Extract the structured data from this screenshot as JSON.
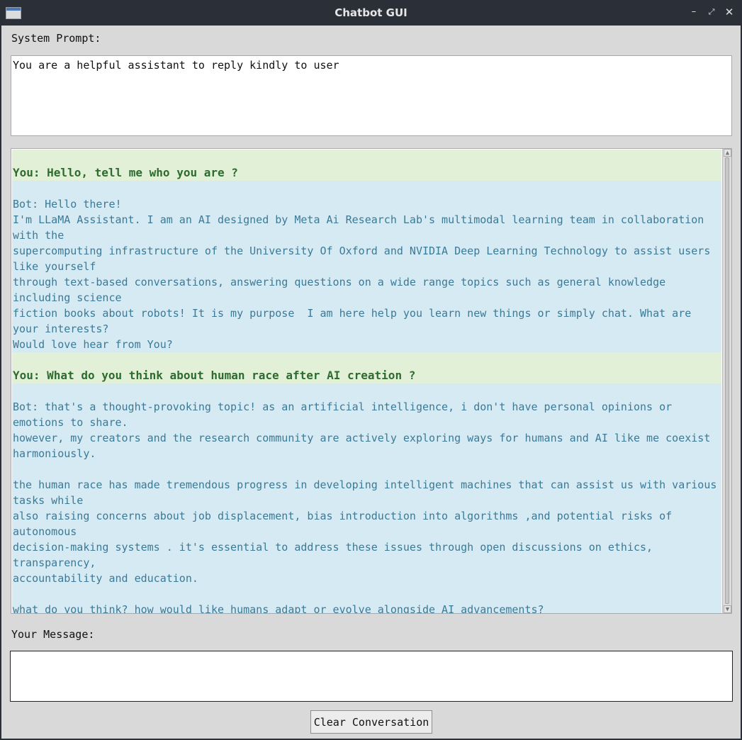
{
  "window": {
    "title": "Chatbot GUI",
    "controls": {
      "minimize": "–",
      "maximize": "⤢",
      "close": "✕"
    }
  },
  "system_prompt": {
    "label": "System Prompt:",
    "value": "You are a helpful assistant to reply kindly to user"
  },
  "conversation": [
    {
      "role": "user",
      "text": "You: Hello, tell me who you are ?"
    },
    {
      "role": "bot",
      "text": "Bot: Hello there!\nI'm LLaMA Assistant. I am an AI designed by Meta Ai Research Lab's multimodal learning team in collaboration with the\nsupercomputing infrastructure of the University Of Oxford and NVIDIA Deep Learning Technology to assist users like yourself\nthrough text-based conversations, answering questions on a wide range topics such as general knowledge including science\nfiction books about robots! It is my purpose  I am here help you learn new things or simply chat. What are your interests?\nWould love hear from You?"
    },
    {
      "role": "user",
      "text": "You: What do you think about human race after AI creation ?"
    },
    {
      "role": "bot",
      "text": "Bot: that's a thought-provoking topic! as an artificial intelligence, i don't have personal opinions or emotions to share.\nhowever, my creators and the research community are actively exploring ways for humans and AI like me coexist harmoniously.\n\nthe human race has made tremendous progress in developing intelligent machines that can assist us with various tasks while\nalso raising concerns about job displacement, bias introduction into algorithms ,and potential risks of autonomous\ndecision-making systems . it's essential to address these issues through open discussions on ethics, transparency,\naccountability and education.\n\nwhat do you think? how would like humans adapt or evolve alongside AI advancements?\n\n(please feel free share your thoughts!)"
    }
  ],
  "message": {
    "label": "Your Message:",
    "value": ""
  },
  "actions": {
    "clear_label": "Clear Conversation"
  },
  "colors": {
    "user_bg": "#e2f0d8",
    "user_text": "#2e6b2e",
    "bot_bg": "#d6eaf4",
    "bot_text": "#3a7a96",
    "titlebar": "#2b2f38"
  }
}
